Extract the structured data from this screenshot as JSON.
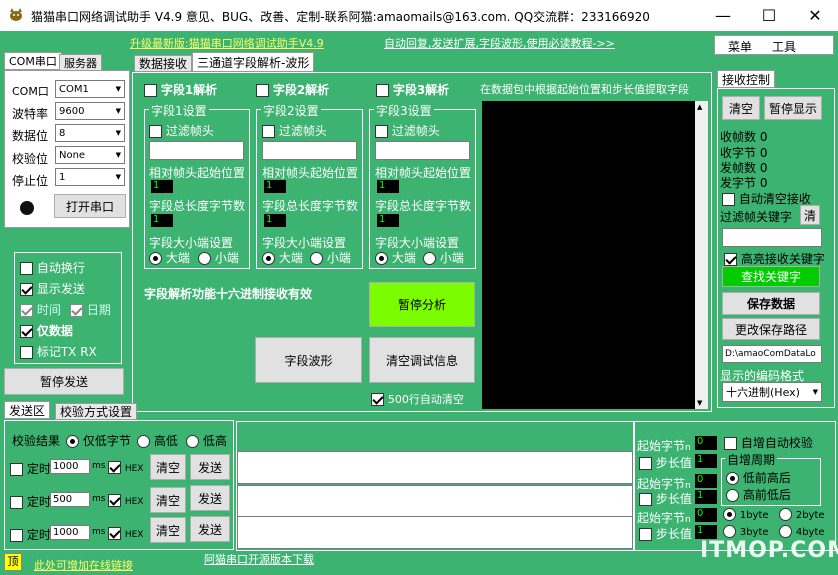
{
  "window": {
    "title": "猫猫串口网络调试助手 V4.9 意见、BUG、改善、定制-联系阿猫:amaomails@163.com. QQ交流群：233166920",
    "minimize": "—",
    "maximize": "☐",
    "close": "✕"
  },
  "top_links": {
    "upgrade": "升级最新版:猫猫串口网络调试助手V4.9",
    "tutorial": "自动回复,发送扩展,字段波形,使用必读教程->>"
  },
  "menu": {
    "menu": "菜单",
    "tools": "工具"
  },
  "left_tabs": {
    "com": "COM串口",
    "server": "服务器"
  },
  "serial": {
    "port_label": "COM口",
    "port_value": "COM1",
    "baud_label": "波特率",
    "baud_value": "9600",
    "data_label": "数据位",
    "data_value": "8",
    "parity_label": "校验位",
    "parity_value": "None",
    "stop_label": "停止位",
    "stop_value": "1",
    "open_button": "打开串口"
  },
  "options": {
    "auto_wrap": "自动换行",
    "show_send": "显示发送",
    "time": "时间",
    "date": "日期",
    "data_only": "仅数据",
    "tag_txrx": "标记TX RX",
    "pause_send": "暂停发送"
  },
  "center_tabs": {
    "receive": "数据接收",
    "three_channel": "三通道字段解析-波形"
  },
  "fields": [
    {
      "enable": "字段1解析",
      "settings": "字段1设置",
      "filter": "过滤帧头",
      "offset": "相对帧头起始位置",
      "offset_val": "1",
      "length": "字段总长度字节数",
      "length_val": "1",
      "endian": "字段大小端设置",
      "big": "大端",
      "little": "小端"
    },
    {
      "enable": "字段2解析",
      "settings": "字段2设置",
      "filter": "过滤帧头",
      "offset": "相对帧头起始位置",
      "offset_val": "1",
      "length": "字段总长度字节数",
      "length_val": "1",
      "endian": "字段大小端设置",
      "big": "大端",
      "little": "小端"
    },
    {
      "enable": "字段3解析",
      "settings": "字段3设置",
      "filter": "过滤帧头",
      "offset": "相对帧头起始位置",
      "offset_val": "1",
      "length": "字段总长度字节数",
      "length_val": "1",
      "endian": "字段大小端设置",
      "big": "大端",
      "little": "小端"
    }
  ],
  "parse": {
    "hint": "在数据包中根据起始位置和步长值提取字段",
    "hex_note": "字段解析功能十六进制接收有效",
    "pause_analysis": "暂停分析",
    "waveform": "字段波形",
    "clear_debug": "清空调试信息",
    "auto_clear": "500行自动清空"
  },
  "recv_ctrl": {
    "tab": "接收控制",
    "clear": "清空",
    "pause_show": "暂停显示",
    "recv_frames": "收帧数",
    "recv_frames_val": "0",
    "recv_bytes": "收字节",
    "recv_bytes_val": "0",
    "send_frames": "发帧数",
    "send_frames_val": "0",
    "send_bytes": "发字节",
    "send_bytes_val": "0",
    "auto_clear_recv": "自动清空接收",
    "filter_kw": "过滤帧关键字",
    "clear_kw": "清",
    "highlight_kw": "高亮接收关键字",
    "find_kw": "查找关键字",
    "save_data": "保存数据",
    "change_path": "更改保存路径",
    "path": "D:\\amaoComDataLo",
    "encoding_label": "显示的编码格式",
    "encoding_value": "十六进制(Hex)"
  },
  "send_tabs": {
    "send_area": "发送区",
    "checksum_mode": "校验方式设置"
  },
  "send": {
    "checksum_result": "校验结果",
    "low_only": "仅低字节",
    "high_low": "高低",
    "low_high": "低高",
    "rows": [
      {
        "timer": "定时",
        "interval": "1000",
        "unit": "ms",
        "hex": "HEX",
        "clear": "清空",
        "send": "发送"
      },
      {
        "timer": "定时",
        "interval": "500",
        "unit": "ms",
        "hex": "HEX",
        "clear": "清空",
        "send": "发送"
      },
      {
        "timer": "定时",
        "interval": "1000",
        "unit": "ms",
        "hex": "HEX",
        "clear": "清空",
        "send": "发送"
      }
    ]
  },
  "checksum": {
    "start_byte": "起始字节",
    "step": "步长值",
    "n_label": "n",
    "start_vals": [
      "0",
      "0",
      "0"
    ],
    "step_vals": [
      "1",
      "1",
      "1"
    ],
    "auto_inc": "自增自动校验",
    "inc_cycle": "自增周期",
    "low_first": "低前高后",
    "high_first": "高前低后",
    "b1": "1byte",
    "b2": "2byte",
    "b3": "3byte",
    "b4": "4byte"
  },
  "footer": {
    "top_badge": "顶",
    "add_link": "此处可增加在线链接",
    "download": "阿猫串口开源版本下载"
  },
  "watermark": "ITMOP.COM",
  "colors": {
    "background": "#3cb371",
    "bright_green": "#7cfc00",
    "find_green": "#00cc00"
  }
}
